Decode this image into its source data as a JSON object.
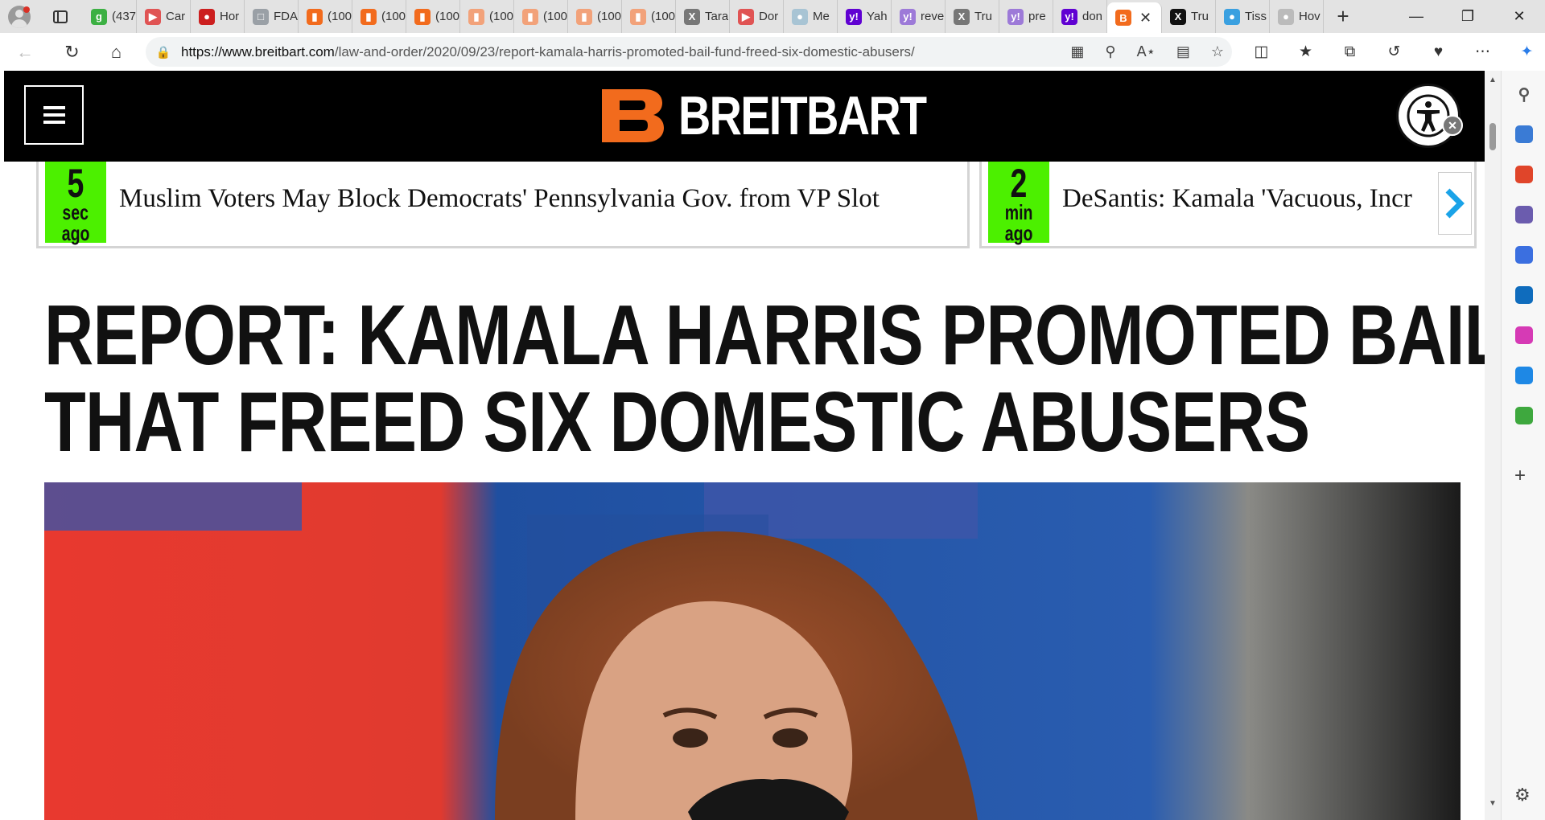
{
  "browser": {
    "tabs": [
      {
        "title": "(437",
        "favicon": "g-icon",
        "color": "#3cb043"
      },
      {
        "title": "Car",
        "favicon": "video-icon",
        "color": "#e05454"
      },
      {
        "title": "Hor",
        "favicon": "news-icon",
        "color": "#cc1f1f"
      },
      {
        "title": "FDA",
        "favicon": "document-icon",
        "color": "#9aa0a6"
      },
      {
        "title": "(100",
        "favicon": "bookmark-icon",
        "color": "#f26b1d"
      },
      {
        "title": "(100",
        "favicon": "bookmark-icon",
        "color": "#f26b1d"
      },
      {
        "title": "(100",
        "favicon": "bookmark-icon",
        "color": "#f26b1d"
      },
      {
        "title": "(100",
        "favicon": "bookmark-icon",
        "color": "#f2a27a"
      },
      {
        "title": "(100",
        "favicon": "bookmark-icon",
        "color": "#f2a27a"
      },
      {
        "title": "(100",
        "favicon": "bookmark-icon",
        "color": "#f2a27a"
      },
      {
        "title": "(100",
        "favicon": "bookmark-icon",
        "color": "#f2a27a"
      },
      {
        "title": "Tara",
        "favicon": "x-icon",
        "color": "#777777"
      },
      {
        "title": "Dor",
        "favicon": "video-icon",
        "color": "#e05454"
      },
      {
        "title": "Me",
        "favicon": "web-icon",
        "color": "#a8c4d4"
      },
      {
        "title": "Yah",
        "favicon": "yahoo-icon",
        "color": "#6001d2"
      },
      {
        "title": "reve",
        "favicon": "yahoo-icon",
        "color": "#9d7ad8"
      },
      {
        "title": "Tru",
        "favicon": "x-icon",
        "color": "#777777"
      },
      {
        "title": "pre",
        "favicon": "yahoo-icon",
        "color": "#9d7ad8"
      },
      {
        "title": "don",
        "favicon": "yahoo-icon",
        "color": "#6001d2"
      }
    ],
    "active_tab": {
      "favicon": "breitbart-icon",
      "color": "#f26b1d"
    },
    "tabs_after": [
      {
        "title": "Tru",
        "favicon": "x-icon",
        "color": "#111111"
      },
      {
        "title": "Tiss",
        "favicon": "web-icon",
        "color": "#3aa0e0"
      },
      {
        "title": "Hov",
        "favicon": "web-icon",
        "color": "#bbbbbb"
      }
    ],
    "url_host": "https://www.breitbart.com",
    "url_path": "/law-and-order/2020/09/23/report-kamala-harris-promoted-bail-fund-freed-six-domestic-abusers/",
    "sidebar_icons": [
      {
        "name": "search-icon",
        "color": "#555555"
      },
      {
        "name": "shopping-tag-icon",
        "color": "#3a7bd5"
      },
      {
        "name": "tools-briefcase-icon",
        "color": "#e0452a"
      },
      {
        "name": "games-icon",
        "color": "#6b5cae"
      },
      {
        "name": "copilot-icon",
        "color": "#3b6fe0"
      },
      {
        "name": "outlook-icon",
        "color": "#0f6cbd"
      },
      {
        "name": "designer-icon",
        "color": "#d63ab5"
      },
      {
        "name": "send-icon",
        "color": "#1e88e5"
      },
      {
        "name": "tree-icon",
        "color": "#3ea83e"
      }
    ]
  },
  "site": {
    "logo_text": "BREITBART",
    "brand_color": "#f26b1d"
  },
  "ticker": [
    {
      "num": "5",
      "unit": "sec",
      "ago": "ago",
      "text": "Muslim Voters May Block Democrats' Pennsylvania Gov. from VP Slot"
    },
    {
      "num": "2",
      "unit": "min",
      "ago": "ago",
      "text": "DeSantis: Kamala 'Vacuous, Incr"
    }
  ],
  "article": {
    "headline_line1": "REPORT: KAMALA HARRIS PROMOTED BAIL FUND",
    "headline_line2": "THAT FREED SIX DOMESTIC ABUSERS"
  }
}
